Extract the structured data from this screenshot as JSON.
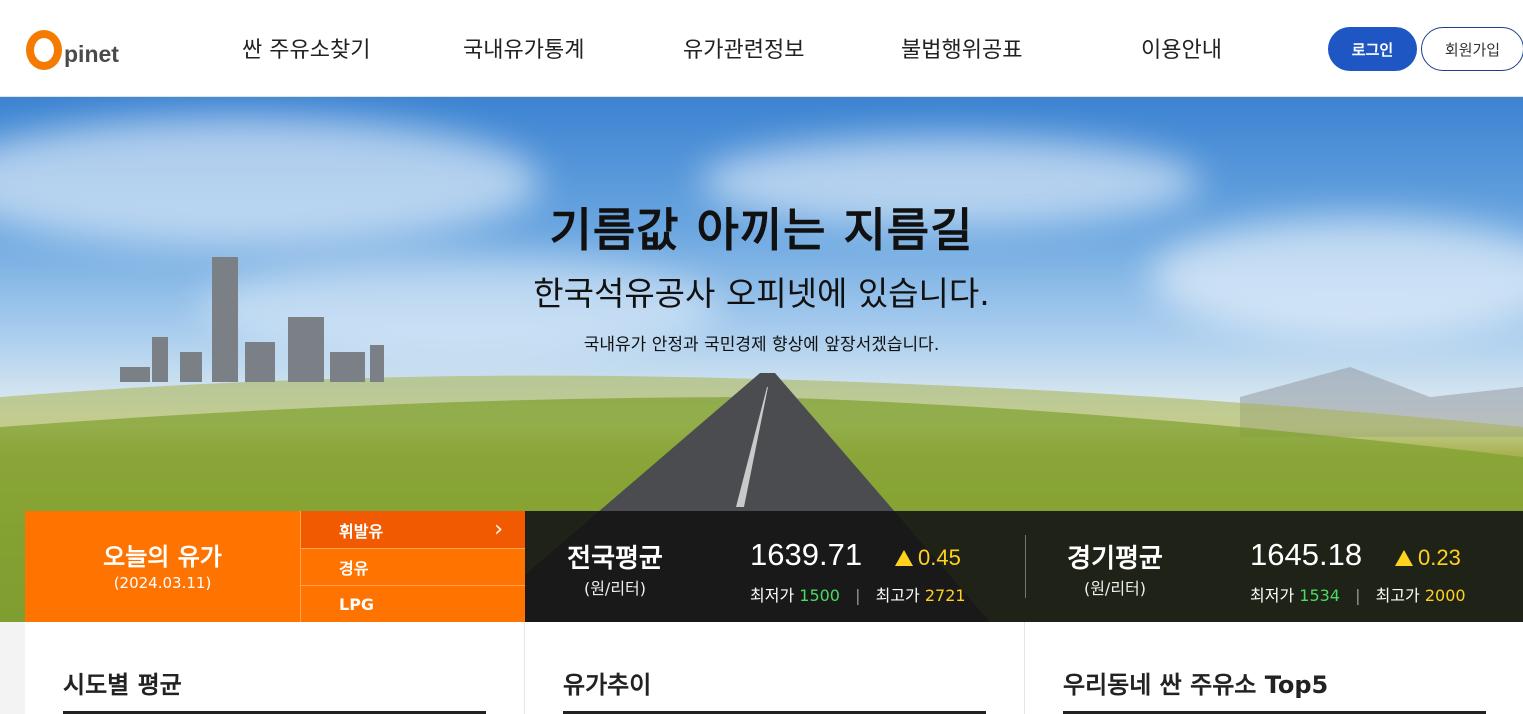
{
  "header": {
    "logo_first": "O",
    "logo_rest": "pinet",
    "nav": [
      "싼 주유소찾기",
      "국내유가통계",
      "유가관련정보",
      "불법행위공표",
      "이용안내"
    ],
    "login": "로그인",
    "join": "회원가입"
  },
  "hero": {
    "title": "기름값 아끼는 지름길",
    "subtitle": "한국석유공사 오피넷에 있습니다.",
    "tagline": "국내유가 안정과 국민경제 향상에 앞장서겠습니다."
  },
  "today": {
    "title": "오늘의 유가",
    "date": "(2024.03.11)",
    "fuels": [
      "휘발유",
      "경유",
      "LPG"
    ],
    "active_fuel": "휘발유"
  },
  "national": {
    "name": "전국평균",
    "unit": "(원/리터)",
    "price": "1639.71",
    "change": "0.45",
    "min_label": "최저가",
    "min": "1500",
    "max_label": "최고가",
    "max": "2721"
  },
  "regional": {
    "name": "경기평균",
    "unit": "(원/리터)",
    "price": "1645.18",
    "change": "0.23",
    "min_label": "최저가",
    "min": "1534",
    "max_label": "최고가",
    "max": "2000"
  },
  "cards": [
    "시도별 평균",
    "유가추이",
    "우리동네 싼 주유소 Top5"
  ],
  "colors": {
    "orange": "#ff7300",
    "blue": "#1e56c3",
    "up": "#ffd21f",
    "min": "#4cd964"
  }
}
